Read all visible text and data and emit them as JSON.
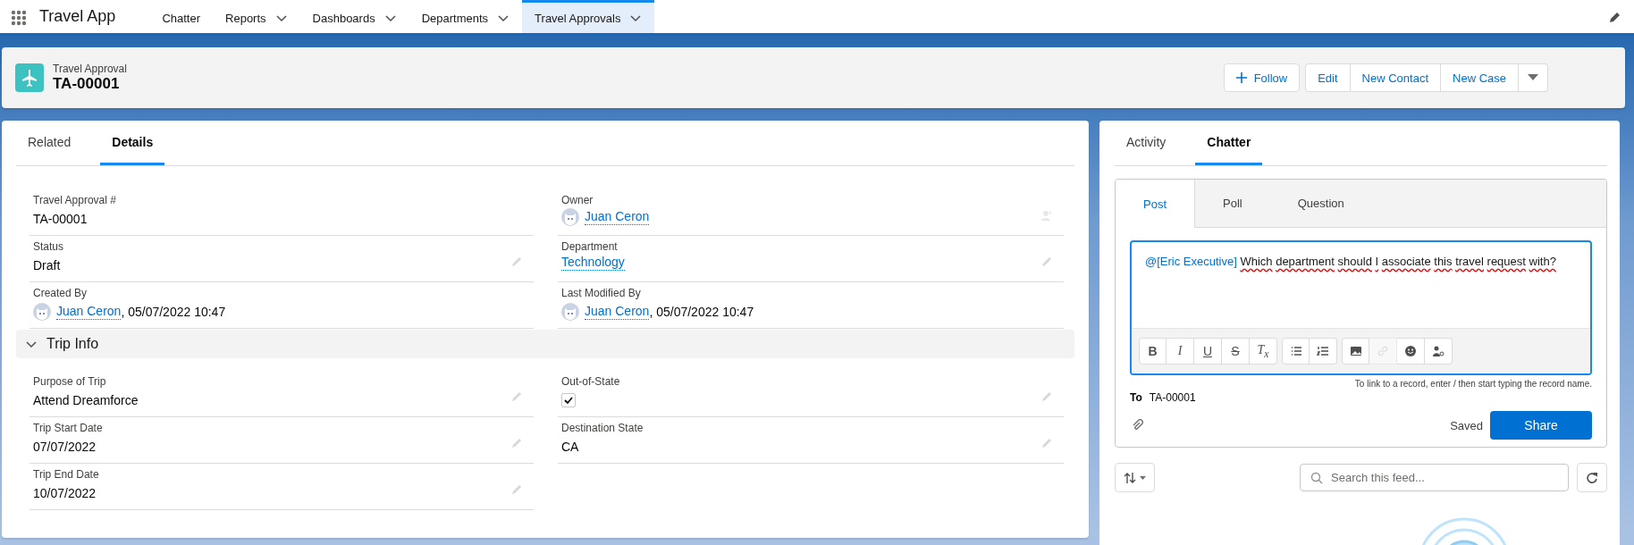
{
  "app": {
    "name": "Travel App"
  },
  "nav_items": [
    {
      "label": "Chatter",
      "has_menu": false,
      "selected": false
    },
    {
      "label": "Reports",
      "has_menu": true,
      "selected": false
    },
    {
      "label": "Dashboards",
      "has_menu": true,
      "selected": false
    },
    {
      "label": "Departments",
      "has_menu": true,
      "selected": false
    },
    {
      "label": "Travel Approvals",
      "has_menu": true,
      "selected": true
    }
  ],
  "record_header": {
    "object_type": "Travel Approval",
    "title": "TA-00001",
    "actions": [
      {
        "kind": "follow",
        "label": "Follow"
      },
      {
        "kind": "button",
        "label": "Edit"
      },
      {
        "kind": "button",
        "label": "New Contact"
      },
      {
        "kind": "button",
        "label": "New Case"
      },
      {
        "kind": "menu"
      }
    ]
  },
  "detail_tabs": [
    {
      "label": "Related",
      "selected": false
    },
    {
      "label": "Details",
      "selected": true
    }
  ],
  "sections": [
    {
      "rows": [
        {
          "cells": [
            {
              "kind": "text",
              "label": "Travel Approval #",
              "value": "TA-00001",
              "editable": false
            },
            {
              "kind": "user",
              "label": "Owner",
              "value": "Juan Ceron",
              "editable": true
            }
          ]
        },
        {
          "cells": [
            {
              "kind": "text",
              "label": "Status",
              "value": "Draft",
              "editable": true
            },
            {
              "kind": "link",
              "label": "Department",
              "value": "Technology",
              "editable": true
            }
          ]
        },
        {
          "cells": [
            {
              "kind": "user",
              "label": "Created By",
              "value": "Juan Ceron",
              "date": ", 05/07/2022 10:47",
              "editable": false
            },
            {
              "kind": "user",
              "label": "Last Modified By",
              "value": "Juan Ceron",
              "date": ", 05/07/2022 10:47",
              "editable": false
            }
          ]
        }
      ]
    },
    {
      "title": "Trip Info",
      "expanded": true,
      "rows": [
        {
          "cells": [
            {
              "kind": "text",
              "label": "Purpose of Trip",
              "value": "Attend Dreamforce",
              "editable": true
            },
            {
              "kind": "checkbox",
              "label": "Out-of-State",
              "checked": true,
              "editable": true
            }
          ]
        },
        {
          "cells": [
            {
              "kind": "text",
              "label": "Trip Start Date",
              "value": "07/07/2022",
              "editable": true
            },
            {
              "kind": "text",
              "label": "Destination State",
              "value": "CA",
              "editable": true
            }
          ]
        },
        {
          "cells": [
            {
              "kind": "text",
              "label": "Trip End Date",
              "value": "10/07/2022",
              "editable": true
            }
          ]
        }
      ]
    }
  ],
  "side_tabs": [
    {
      "label": "Activity",
      "selected": false
    },
    {
      "label": "Chatter",
      "selected": true
    }
  ],
  "publisher": {
    "tabs": [
      {
        "label": "Post",
        "selected": true
      },
      {
        "label": "Poll",
        "selected": false
      },
      {
        "label": "Question",
        "selected": false
      }
    ],
    "mention": "@[Eric Executive]",
    "message": "Which department should I associate this travel request with?",
    "toolbar": [
      {
        "kind": "bold",
        "glyph": "B",
        "disabled": false
      },
      {
        "kind": "italic",
        "glyph": "I",
        "disabled": false
      },
      {
        "kind": "underline",
        "glyph": "U",
        "disabled": false
      },
      {
        "kind": "strike",
        "glyph": "S",
        "disabled": false
      },
      {
        "kind": "clear",
        "glyph": "T$_{x}$",
        "disabled": false
      },
      {
        "kind": "bullets",
        "disabled": false
      },
      {
        "kind": "numbers",
        "disabled": false
      },
      {
        "kind": "image",
        "disabled": false
      },
      {
        "kind": "link",
        "disabled": true
      },
      {
        "kind": "emoji",
        "disabled": false
      },
      {
        "kind": "mention",
        "disabled": false
      }
    ],
    "hint": "To link to a record, enter / then start typing the record name.",
    "to_label": "To",
    "to_value": "TA-00001",
    "status": "Saved",
    "share_label": "Share"
  },
  "feed": {
    "search_placeholder": "Search this feed..."
  }
}
